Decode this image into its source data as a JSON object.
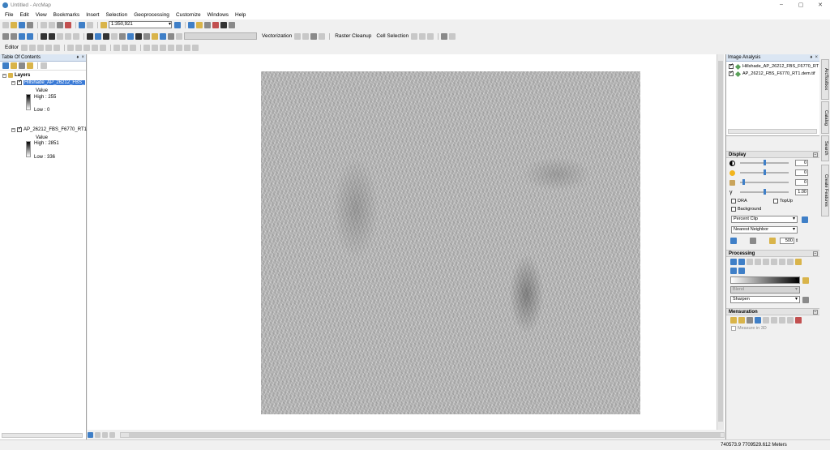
{
  "window": {
    "title": "Untitled - ArcMap",
    "min": "–",
    "max": "▢",
    "close": "✕"
  },
  "menu": [
    "File",
    "Edit",
    "View",
    "Bookmarks",
    "Insert",
    "Selection",
    "Geoprocessing",
    "Customize",
    "Windows",
    "Help"
  ],
  "toolbar": {
    "scale": "1:350,921",
    "vectorization": "Vectorization",
    "raster_cleanup": "Raster Cleanup",
    "cell_selection": "Cell Selection",
    "editor": "Editor"
  },
  "toc": {
    "title": "Table Of Contents",
    "pin": "♦",
    "close": "×",
    "root": "Layers",
    "layers": [
      {
        "name": "Hillshade_AP_26212_FBS_",
        "value_label": "Value",
        "high": "High : 255",
        "low": "Low : 0"
      },
      {
        "name": "AP_26212_FBS_F6770_RT1",
        "value_label": "Value",
        "high": "High : 2851",
        "low": "Low : 336"
      }
    ]
  },
  "image_analysis": {
    "title": "Image Analysis",
    "layers": [
      "Hillshade_AP_26212_FBS_F6770_RT",
      "AP_26212_FBS_F6770_RT1.dem.tif"
    ],
    "display": {
      "title": "Display",
      "sliders": [
        {
          "icon": "contrast-icon",
          "value": "0",
          "knob": 0.5
        },
        {
          "icon": "brightness-icon",
          "value": "0",
          "knob": 0.5
        },
        {
          "icon": "transparency-icon",
          "value": "0",
          "knob": 0.05
        },
        {
          "icon": "gamma-icon",
          "label": "γ",
          "value": "1.00",
          "knob": 0.5
        }
      ],
      "dra": "DRA",
      "topup": "TopUp",
      "background": "Background",
      "stretch": "Percent Clip",
      "resample": "Nearest Neighbor",
      "zoom_value": "500"
    },
    "processing": {
      "title": "Processing",
      "blend": "Blend",
      "sharpen": "Sharpen"
    },
    "mensuration": {
      "title": "Mensuration",
      "measure_3d": "Measure in 3D"
    }
  },
  "side_tabs": [
    "ArcToolbox",
    "Catalog",
    "Search",
    "Create Features"
  ],
  "status": {
    "coords": "740573.9  7709529.612 Meters"
  },
  "colors": {
    "selection": "#3a7ad6",
    "pane_header": "#dbe6f3"
  }
}
